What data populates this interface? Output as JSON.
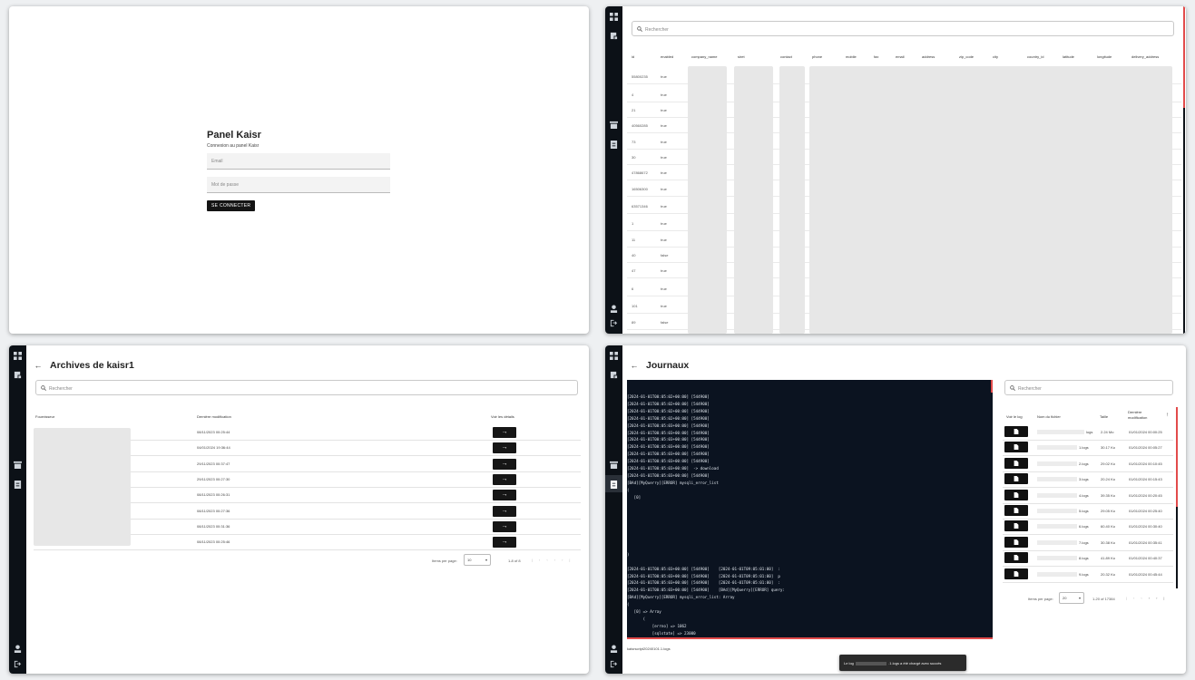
{
  "login": {
    "title": "Panel Kaisr",
    "subtitle": "Connexion au panel Kaisr",
    "email_placeholder": "Email",
    "password_placeholder": "Mot de passe",
    "submit_label": "SE CONNECTER"
  },
  "companies": {
    "search_placeholder": "Rechercher",
    "columns": [
      "id",
      "enabled",
      "company_name",
      "siret",
      "contact",
      "phone",
      "mobile",
      "fax",
      "email",
      "address",
      "zip_code",
      "city",
      "country_id",
      "latitude",
      "longitude",
      "delivery_address"
    ],
    "rows": [
      {
        "id": "55800235",
        "enabled": "true"
      },
      {
        "id": "4",
        "enabled": "true"
      },
      {
        "id": "21",
        "enabled": "true"
      },
      {
        "id": "40560285",
        "enabled": "true"
      },
      {
        "id": "73",
        "enabled": "true"
      },
      {
        "id": "30",
        "enabled": "true"
      },
      {
        "id": "47868672",
        "enabled": "true"
      },
      {
        "id": "16506300",
        "enabled": "true"
      },
      {
        "id": "63571346",
        "enabled": "true"
      },
      {
        "id": "1",
        "enabled": "true"
      },
      {
        "id": "11",
        "enabled": "true"
      },
      {
        "id": "40",
        "enabled": "false"
      },
      {
        "id": "47",
        "enabled": "true"
      },
      {
        "id": "6",
        "enabled": "true"
      },
      {
        "id": "101",
        "enabled": "true"
      },
      {
        "id": "89",
        "enabled": "false"
      }
    ]
  },
  "archives": {
    "title": "Archives de kaisr1",
    "search_placeholder": "Rechercher",
    "col_supplier": "Fournisseur",
    "col_modified": "Dernière modification",
    "col_details": "Voir les détails",
    "rows": [
      {
        "modified": "08/11/2023 00:25:44"
      },
      {
        "modified": "04/01/2024 19:36:44"
      },
      {
        "modified": "29/11/2023 00:37:47"
      },
      {
        "modified": "29/11/2023 00:27:30"
      },
      {
        "modified": "08/11/2023 00:26:31"
      },
      {
        "modified": "08/11/2023 00:27:36"
      },
      {
        "modified": "08/11/2023 00:31:36"
      },
      {
        "modified": "08/11/2023 00:25:46"
      }
    ],
    "items_per_page_label": "Items per page:",
    "items_per_page": "10",
    "range": "1-8 of 8"
  },
  "journaux": {
    "title": "Journaux",
    "search_placeholder": "Rechercher",
    "terminal_lines": [
      "[2024-01-01T00:05:02+00:00] [544900]",
      "[2024-01-01T00:05:02+00:00] [544900]",
      "[2024-01-01T00:05:02+00:00] [544900]",
      "[2024-01-01T00:05:02+00:00] [544900]",
      "[2024-01-01T00:05:03+00:00] [544900]",
      "[2024-01-01T00:05:03+00:00] [544900]",
      "[2024-01-01T00:05:03+00:00] [544900]",
      "[2024-01-01T00:05:03+00:00] [544900]",
      "[2024-01-01T00:05:03+00:00] [544900]",
      "[2024-01-01T00:05:03+00:00] [544900]",
      "[2024-01-01T00:05:03+00:00]  -> download",
      "[2024-01-01T00:05:03+00:00] [544900]",
      "[BAd][MyQuerry][ERROR] mysqli_error_list",
      "(",
      "   [0]",
      "",
      "",
      "",
      "",
      "",
      "",
      "",
      ")",
      "",
      "[2024-01-01T00:05:03+00:00] [544900]    [2024-01-01T09:05:01:00]  :",
      "[2024-01-01T00:05:03+00:00] [544900]    [2024-01-01T09:05:01:00]  p",
      "[2024-01-01T00:05:03+00:00] [544900]    [2024-01-01T09:05:01:00]  :",
      "[2024-01-01T00:05:03+00:00] [544900]    [BAd][MyQuerry][ERROR] query:",
      "[BAd][MyQuerry][ERROR] mysqli_error_list: Array",
      "(",
      "   [0] => Array",
      "       (",
      "           [errno] => 1062",
      "           [sqlstate] => 23000"
    ],
    "log_filename": "kaisrscript20240101.1.logs",
    "col_view": "Voir le log",
    "col_name": "Nom du fichier",
    "col_size": "Taille",
    "col_modified": "Dernière modification",
    "files": [
      {
        "name": "logs",
        "size": "2.24 Mo",
        "modified": "01/01/2024 00:00:25"
      },
      {
        "name": "1.logs",
        "size": "30.17 Ko",
        "modified": "01/01/2024 00:05:27"
      },
      {
        "name": "2.logs",
        "size": "29.02 Ko",
        "modified": "01/01/2024 00:10:45"
      },
      {
        "name": "3.logs",
        "size": "20.24 Ko",
        "modified": "01/01/2024 00:15:43"
      },
      {
        "name": "4.logs",
        "size": "39.35 Ko",
        "modified": "01/01/2024 00:20:45"
      },
      {
        "name": "5.logs",
        "size": "29.05 Ko",
        "modified": "01/01/2024 00:25:40"
      },
      {
        "name": "6.logs",
        "size": "60.40 Ko",
        "modified": "01/01/2024 00:30:40"
      },
      {
        "name": "7.logs",
        "size": "30.38 Ko",
        "modified": "01/01/2024 00:35:41"
      },
      {
        "name": "8.logs",
        "size": "41.89 Ko",
        "modified": "01/01/2024 00:40:37"
      },
      {
        "name": "9.logs",
        "size": "20.32 Ko",
        "modified": "01/01/2024 00:45:44"
      }
    ],
    "items_per_page_label": "Items per page:",
    "items_per_page": "20",
    "range": "1-20 of 17384",
    "toast_label": "Le log",
    "toast_message": ".1.logs a été chargé avec succès"
  }
}
